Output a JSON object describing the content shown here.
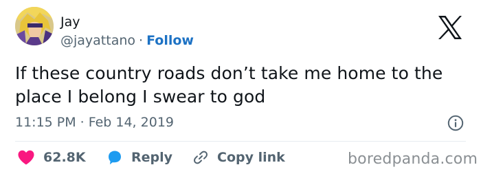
{
  "author": {
    "display_name": "Jay",
    "handle": "@jayattano",
    "separator": "·",
    "follow_label": "Follow"
  },
  "icons": {
    "platform_logo": "x-logo-icon",
    "info": "info-icon",
    "like": "heart-icon",
    "reply": "speech-bubble-icon",
    "copy": "link-icon"
  },
  "tweet": {
    "text": "If these country roads don’t take me home to the place I belong I swear to god",
    "time": "11:15 PM",
    "separator": "·",
    "date": "Feb 14, 2019"
  },
  "actions": {
    "like_count": "62.8K",
    "reply_label": "Reply",
    "copy_label": "Copy link"
  },
  "watermark": "boredpanda.com",
  "colors": {
    "like": "#f91880",
    "reply": "#1d9bf0",
    "follow": "#1d72c4",
    "secondary_text": "#536471"
  }
}
